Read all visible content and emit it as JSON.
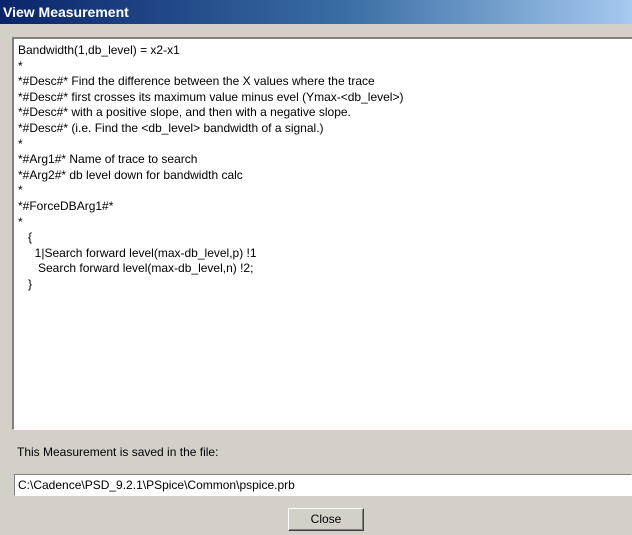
{
  "window": {
    "title": "View Measurement"
  },
  "editor": {
    "lines": [
      "Bandwidth(1,db_level) = x2-x1",
      "*",
      "*#Desc#* Find the difference between the X values where the trace",
      "*#Desc#* first crosses its maximum value minus evel (Ymax-<db_level>)",
      "*#Desc#* with a positive slope, and then with a negative slope.",
      "*#Desc#* (i.e. Find the <db_level> bandwidth of a signal.)",
      "*",
      "*#Arg1#* Name of trace to search",
      "*#Arg2#* db level down for bandwidth calc",
      "*",
      "*#ForceDBArg1#*",
      "*",
      "   {",
      "     1|Search forward level(max-db_level,p) !1",
      "      Search forward level(max-db_level,n) !2;",
      "   }"
    ]
  },
  "footer": {
    "saved_label": "This Measurement is saved in the file:",
    "file_path": "C:\\Cadence\\PSD_9.2.1\\PSpice\\Common\\pspice.prb",
    "close_label": "Close"
  }
}
